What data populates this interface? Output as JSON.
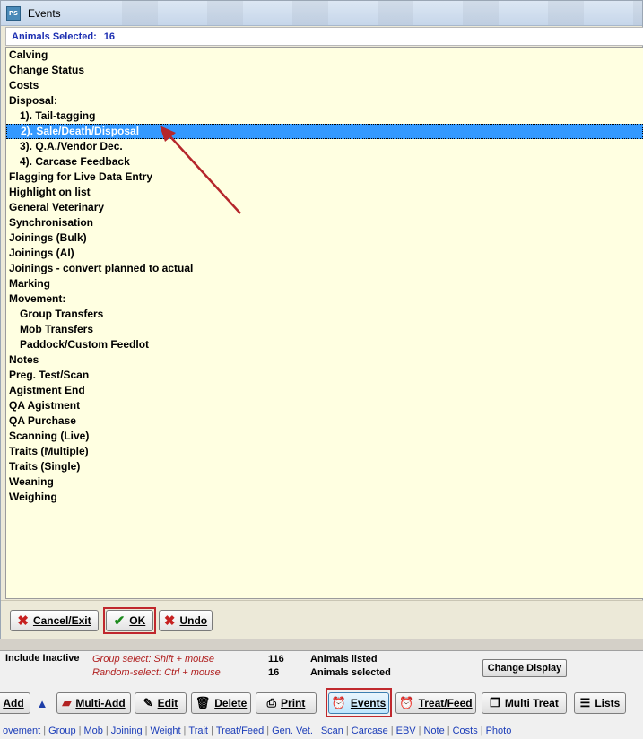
{
  "window": {
    "title": "Events",
    "app_icon": "PS"
  },
  "selection": {
    "label": "Animals Selected:",
    "count": "16"
  },
  "events_list": [
    {
      "label": "Calving",
      "indent": false
    },
    {
      "label": "Change Status",
      "indent": false
    },
    {
      "label": "Costs",
      "indent": false
    },
    {
      "label": "Disposal:",
      "indent": false
    },
    {
      "label": "1). Tail-tagging",
      "indent": true
    },
    {
      "label": "2). Sale/Death/Disposal",
      "indent": true,
      "selected": true
    },
    {
      "label": "3). Q.A./Vendor Dec.",
      "indent": true
    },
    {
      "label": "4). Carcase Feedback",
      "indent": true
    },
    {
      "label": "Flagging for Live Data Entry",
      "indent": false
    },
    {
      "label": "Highlight on list",
      "indent": false
    },
    {
      "label": "General Veterinary",
      "indent": false
    },
    {
      "label": "Synchronisation",
      "indent": false
    },
    {
      "label": "Joinings (Bulk)",
      "indent": false
    },
    {
      "label": "Joinings (AI)",
      "indent": false
    },
    {
      "label": "Joinings - convert planned to actual",
      "indent": false
    },
    {
      "label": "Marking",
      "indent": false
    },
    {
      "label": "Movement:",
      "indent": false
    },
    {
      "label": "Group Transfers",
      "indent": true
    },
    {
      "label": "Mob Transfers",
      "indent": true
    },
    {
      "label": "Paddock/Custom Feedlot",
      "indent": true
    },
    {
      "label": "Notes",
      "indent": false
    },
    {
      "label": "Preg. Test/Scan",
      "indent": false
    },
    {
      "label": "Agistment End",
      "indent": false
    },
    {
      "label": "QA Agistment",
      "indent": false
    },
    {
      "label": "QA Purchase",
      "indent": false
    },
    {
      "label": "Scanning (Live)",
      "indent": false
    },
    {
      "label": "Traits (Multiple)",
      "indent": false
    },
    {
      "label": "Traits (Single)",
      "indent": false
    },
    {
      "label": "Weaning",
      "indent": false
    },
    {
      "label": "Weighing",
      "indent": false
    }
  ],
  "dialog_buttons": {
    "cancel": "Cancel/Exit",
    "ok": "OK",
    "undo": "Undo"
  },
  "status": {
    "include_inactive": "Include Inactive",
    "group_select": "Group select: Shift + mouse",
    "random_select": "Random-select: Ctrl + mouse",
    "listed_count": "116",
    "listed_label": "Animals listed",
    "selected_count": "16",
    "selected_label": "Animals selected",
    "change_display": "Change Display"
  },
  "toolbar": {
    "add": "Add",
    "multi_add": "Multi-Add",
    "edit": "Edit",
    "delete": "Delete",
    "print": "Print",
    "events": "Events",
    "treat_feed": "Treat/Feed",
    "multi_treat": "Multi Treat",
    "lists": "Lists"
  },
  "tabs": [
    "ovement",
    "Group",
    "Mob",
    "Joining",
    "Weight",
    "Trait",
    "Treat/Feed",
    "Gen. Vet.",
    "Scan",
    "Carcase",
    "EBV",
    "Note",
    "Costs",
    "Photo"
  ],
  "colors": {
    "list_bg": "#ffffe1",
    "selection_bg": "#3399ff",
    "count_text": "#1d2fb2",
    "highlight": "#c0282d",
    "tab_link": "#1a3cb8"
  }
}
